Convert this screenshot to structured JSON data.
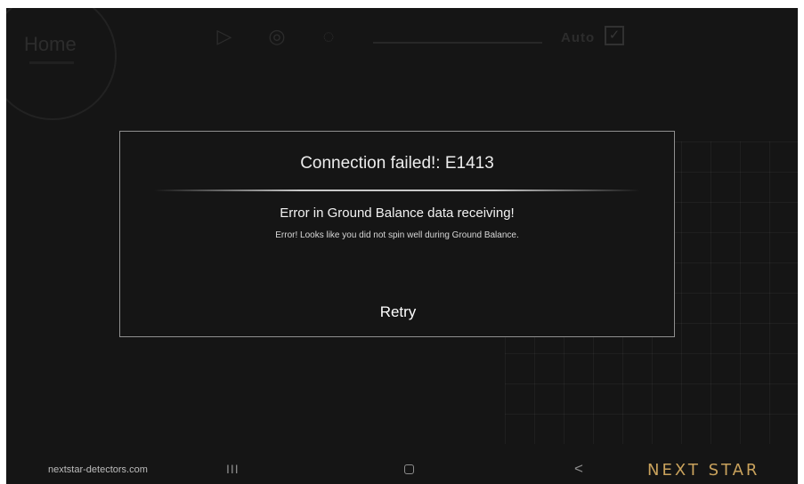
{
  "background": {
    "home_label": "Home",
    "auto_label": "Auto",
    "auto_checked": true
  },
  "dialog": {
    "title": "Connection failed!: E1413",
    "heading": "Error in Ground Balance data receiving!",
    "detail": "Error! Looks like you did not spin well during Ground Balance.",
    "retry_label": "Retry"
  },
  "footer": {
    "site_url": "nextstar-detectors.com",
    "recent_apps_glyph": "III",
    "home_glyph": "home-icon",
    "back_glyph": "<",
    "brand": "NEXT STAR"
  },
  "colors": {
    "screen_bg": "#151515",
    "dialog_border": "#8f8f8f",
    "brand_gold": "#c9a25c"
  }
}
